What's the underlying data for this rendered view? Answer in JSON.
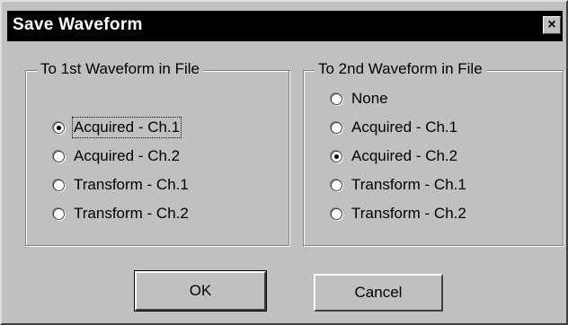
{
  "dialog": {
    "title": "Save Waveform",
    "close_label": "×"
  },
  "group1": {
    "legend": "To 1st Waveform in File",
    "options": [
      {
        "label": "Acquired - Ch.1",
        "checked": true
      },
      {
        "label": "Acquired - Ch.2",
        "checked": false
      },
      {
        "label": "Transform - Ch.1",
        "checked": false
      },
      {
        "label": "Transform - Ch.2",
        "checked": false
      }
    ]
  },
  "group2": {
    "legend": "To 2nd Waveform in File",
    "options": [
      {
        "label": "None",
        "checked": false
      },
      {
        "label": "Acquired - Ch.1",
        "checked": false
      },
      {
        "label": "Acquired - Ch.2",
        "checked": true
      },
      {
        "label": "Transform - Ch.1",
        "checked": false
      },
      {
        "label": "Transform - Ch.2",
        "checked": false
      }
    ]
  },
  "buttons": {
    "ok": "OK",
    "cancel": "Cancel"
  }
}
